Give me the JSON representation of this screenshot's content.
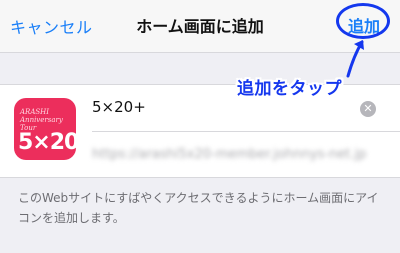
{
  "navbar": {
    "cancel_label": "キャンセル",
    "title": "ホーム画面に追加",
    "add_label": "追加"
  },
  "annotation": {
    "text": "追加をタップ"
  },
  "app_icon": {
    "small_text": "ARASHI Anniversary Tour",
    "big_text": "5×20+"
  },
  "name_field": {
    "value": "5×20+"
  },
  "url_field": {
    "value": "https://arashi5x20-member.johnnys-net.jp"
  },
  "hint": {
    "text": "このWebサイトにすばやくアクセスできるようにホーム画面にアイコンを追加します。"
  },
  "colors": {
    "accent": "#1a7ff8",
    "annotation": "#1537ee",
    "icon_background": "#ec2e5c"
  }
}
